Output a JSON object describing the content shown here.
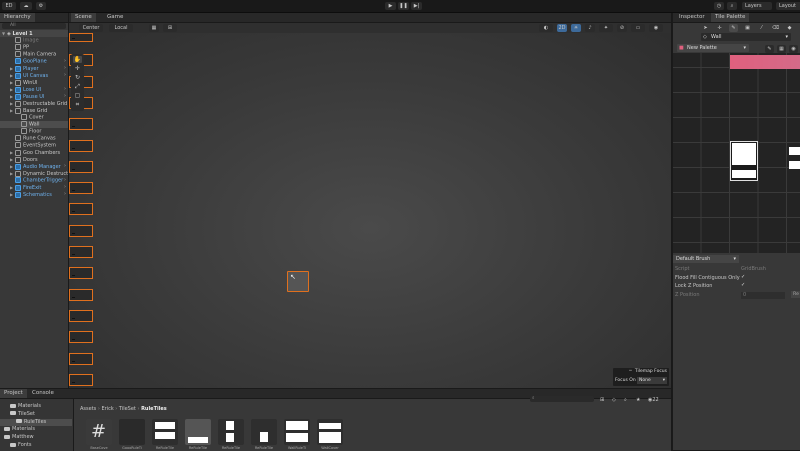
{
  "toolbar": {
    "account_label": "ED",
    "layers_label": "Layers",
    "layout_label": "Layout"
  },
  "hierarchy": {
    "tab_label": "Hierarchy",
    "search_placeholder": "All",
    "scene_name": "Level 1",
    "items": [
      {
        "label": "Image",
        "style": "grey",
        "indent": 1,
        "blue": false,
        "arrow": false
      },
      {
        "label": "PP",
        "style": "normal",
        "indent": 1,
        "blue": false,
        "arrow": false
      },
      {
        "label": "Main Camera",
        "style": "normal",
        "indent": 1,
        "blue": false,
        "arrow": false
      },
      {
        "label": "GooPlane",
        "style": "blue",
        "indent": 1,
        "blue": true,
        "arrow": false
      },
      {
        "label": "Player",
        "style": "blue",
        "indent": 1,
        "blue": true,
        "arrow": true
      },
      {
        "label": "UI Canvas",
        "style": "blue",
        "indent": 1,
        "blue": true,
        "arrow": true
      },
      {
        "label": "WinUI",
        "style": "normal",
        "indent": 1,
        "blue": false,
        "arrow": true
      },
      {
        "label": "Lose UI",
        "style": "blue",
        "indent": 1,
        "blue": true,
        "arrow": true
      },
      {
        "label": "Pause UI",
        "style": "blue",
        "indent": 1,
        "blue": true,
        "arrow": true
      },
      {
        "label": "Destructable Grid",
        "style": "normal",
        "indent": 1,
        "blue": false,
        "arrow": true
      },
      {
        "label": "Base Grid",
        "style": "normal",
        "indent": 1,
        "blue": false,
        "arrow": true
      },
      {
        "label": "Cover",
        "style": "normal",
        "indent": 2,
        "blue": false,
        "arrow": false
      },
      {
        "label": "Wall",
        "style": "normal",
        "indent": 2,
        "blue": false,
        "arrow": false,
        "selected": true
      },
      {
        "label": "Floor",
        "style": "normal",
        "indent": 2,
        "blue": false,
        "arrow": false
      },
      {
        "label": "Rune Canvas",
        "style": "normal",
        "indent": 1,
        "blue": false,
        "arrow": false
      },
      {
        "label": "EventSystem",
        "style": "normal",
        "indent": 1,
        "blue": false,
        "arrow": false
      },
      {
        "label": "Goo Chambers",
        "style": "normal",
        "indent": 1,
        "blue": false,
        "arrow": true
      },
      {
        "label": "Doors",
        "style": "normal",
        "indent": 1,
        "blue": false,
        "arrow": true
      },
      {
        "label": "Audio Manager",
        "style": "blue",
        "indent": 1,
        "blue": true,
        "arrow": true
      },
      {
        "label": "Dynamic Destructi",
        "style": "normal",
        "indent": 1,
        "blue": false,
        "arrow": true
      },
      {
        "label": "ChamberTrigger",
        "style": "blue",
        "indent": 1,
        "blue": true,
        "arrow": false
      },
      {
        "label": "FireExit",
        "style": "blue",
        "indent": 1,
        "blue": true,
        "arrow": true
      },
      {
        "label": "Schematics",
        "style": "blue",
        "indent": 1,
        "blue": true,
        "arrow": true
      }
    ]
  },
  "scene": {
    "tab_scene": "Scene",
    "tab_game": "Game",
    "pivot_label": "Center",
    "space_label": "Local",
    "tilemap_focus_label": "Tilemap Focus",
    "focus_on_label": "Focus On",
    "focus_on_value": "None"
  },
  "inspector": {
    "tab_inspector": "Inspector",
    "tab_palette": "Tile Palette",
    "active_tilemap": "Wall",
    "palette_name": "New Palette",
    "brush_name": "Default Brush",
    "props": [
      {
        "label": "Script",
        "value": "GridBrush",
        "grey": true,
        "check": false
      },
      {
        "label": "Flood Fill Contiguous Only",
        "value": "",
        "grey": false,
        "check": true
      },
      {
        "label": "Lock Z Position",
        "value": "",
        "grey": false,
        "check": true
      },
      {
        "label": "Z Position",
        "value": "0",
        "grey": true,
        "check": false
      }
    ],
    "reset_label": "Re"
  },
  "project": {
    "tab_project": "Project",
    "tab_console": "Console",
    "breadcrumb": [
      "Assets",
      "Erick",
      "TileSet",
      "RuleTiles"
    ],
    "folders": [
      {
        "label": "Materials",
        "indent": 1,
        "selected": false
      },
      {
        "label": "TileSet",
        "indent": 1,
        "selected": false
      },
      {
        "label": "RuleTiles",
        "indent": 2,
        "selected": true
      },
      {
        "label": "Materials",
        "indent": 0,
        "selected": false
      },
      {
        "label": "Matthew",
        "indent": 0,
        "selected": false
      },
      {
        "label": "Fonts",
        "indent": 1,
        "selected": false
      }
    ],
    "assets": [
      "BaseCove",
      "GoooRuleTi",
      "ReRuleTile",
      "ReRuleTile",
      "ReRuleTile",
      "ReRuleTile",
      "WallRuleTi",
      "WallCover"
    ],
    "icon_count": "22"
  },
  "colors": {
    "accent_orange": "#e0701e",
    "accent_pink": "#e0607e",
    "selection_blue": "#4aa0e8"
  }
}
